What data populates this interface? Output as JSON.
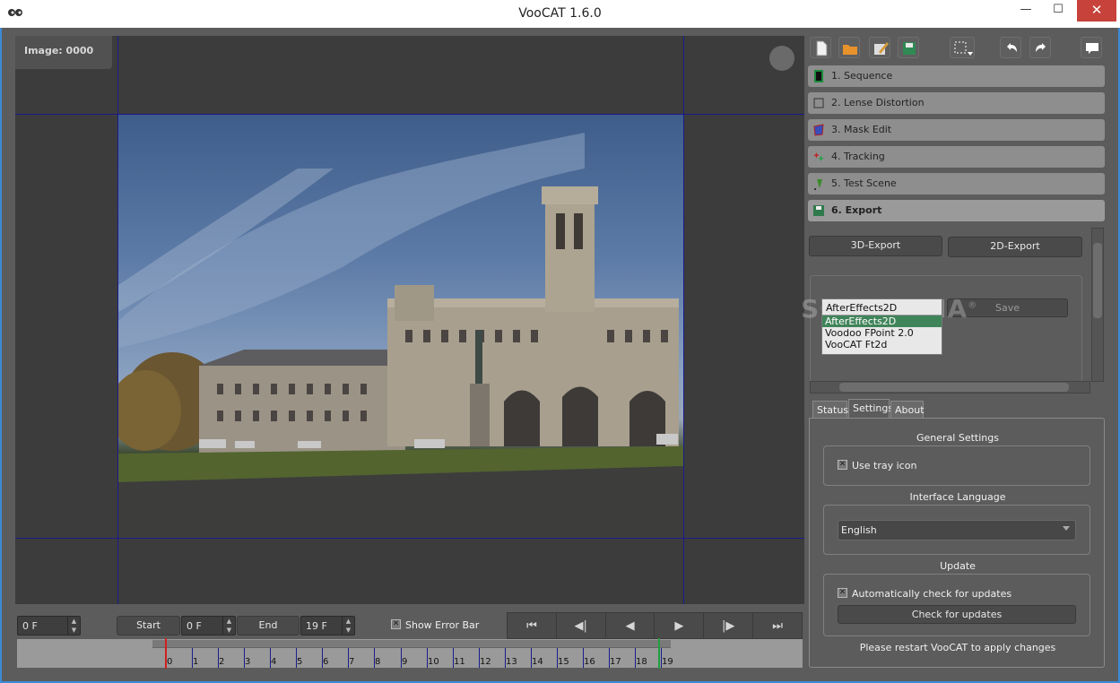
{
  "window": {
    "title": "VooCAT 1.6.0",
    "minimize": "—",
    "maximize": "☐",
    "close": "✕"
  },
  "viewer": {
    "image_label": "Image: 0000"
  },
  "bottom": {
    "current_frame": "0 F",
    "start_label": "Start",
    "start_value": "0 F",
    "end_label": "End",
    "end_value": "19 F",
    "show_error_bar": "Show Error Bar",
    "spin_up": "▲",
    "spin_down": "▼"
  },
  "transport": {
    "first": "⏮",
    "prev_key": "◀|",
    "prev": "◀",
    "play": "▶",
    "next_key": "|▶",
    "last": "⏭"
  },
  "timeline": {
    "labels": [
      "0",
      "1",
      "2",
      "3",
      "4",
      "5",
      "6",
      "7",
      "8",
      "9",
      "10",
      "11",
      "12",
      "13",
      "14",
      "15",
      "16",
      "17",
      "18",
      "19"
    ],
    "start_color": "#d02020",
    "end_color": "#20a040"
  },
  "steps": [
    {
      "label": "1. Sequence",
      "icon": "film-icon"
    },
    {
      "label": "2. Lense Distortion",
      "icon": "lens-grid-icon"
    },
    {
      "label": "3. Mask Edit",
      "icon": "mask-icon"
    },
    {
      "label": "4. Tracking",
      "icon": "tracking-crosses-icon"
    },
    {
      "label": "5. Test Scene",
      "icon": "test-scene-icon"
    },
    {
      "label": "6. Export",
      "icon": "floppy-icon"
    }
  ],
  "export": {
    "btn_3d": "3D-Export",
    "btn_2d": "2D-Export",
    "selected_format": "AfterEffects2D",
    "formats": [
      "AfterEffects2D",
      "Voodoo FPoint 2.0",
      "VooCAT Ft2d"
    ],
    "save_label": "Save",
    "watermark": "SOFTPEDIA",
    "watermark_reg": "®"
  },
  "tabs": {
    "status": "Status",
    "settings": "Settings",
    "about": "About"
  },
  "settings": {
    "general_header": "General Settings",
    "tray_icon_label": "Use tray icon",
    "language_header": "Interface Language",
    "language_value": "English",
    "update_header": "Update",
    "auto_check_label": "Automatically check for updates",
    "check_button": "Check for updates",
    "restart_note": "Please restart VooCAT to apply changes",
    "check_mark": "✕"
  }
}
